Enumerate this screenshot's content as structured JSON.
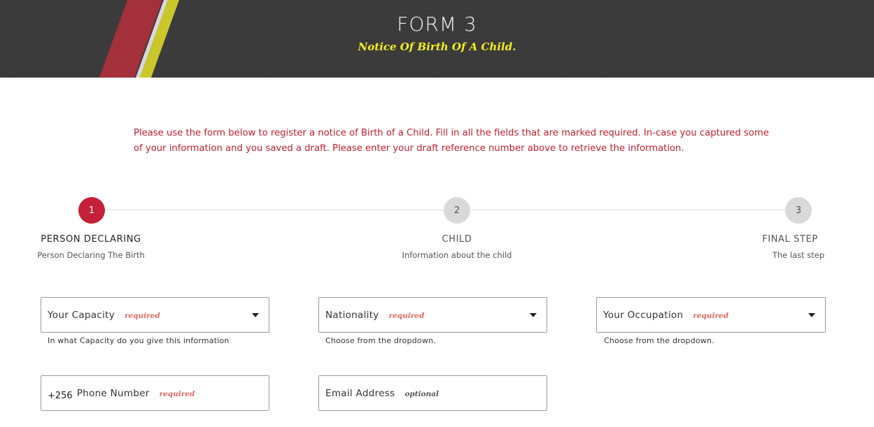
{
  "header": {
    "title": "FORM 3",
    "subtitle": "Notice Of Birth Of A Child.",
    "stripe_colors": [
      "#a3303a",
      "#c9c72a"
    ]
  },
  "intro": {
    "text": "Please use the form below to register a notice of Birth of a Child. Fill in all the fields that are marked required. In-case you captured some of your information and you saved a draft. Please enter your draft reference number above to retrieve the information."
  },
  "steps": [
    {
      "number": "1",
      "title": "PERSON DECLARING",
      "subtitle": "Person Declaring The Birth",
      "active": true
    },
    {
      "number": "2",
      "title": "CHILD",
      "subtitle": "Information about the child",
      "active": false
    },
    {
      "number": "3",
      "title": "FINAL STEP",
      "subtitle": "The last step",
      "active": false
    }
  ],
  "fields": {
    "capacity": {
      "label": "Your Capacity",
      "tag": "required",
      "help": "In what Capacity do you give this information"
    },
    "nationality": {
      "label": "Nationality",
      "tag": "required",
      "help": "Choose from the dropdown."
    },
    "occupation": {
      "label": "Your Occupation",
      "tag": "required",
      "help": "Choose from the dropdown."
    },
    "phone": {
      "prefix": "+256",
      "label": "Phone Number",
      "tag": "required"
    },
    "email": {
      "label": "Email Address",
      "tag": "optional"
    }
  },
  "colors": {
    "accent": "#c5203a",
    "required_tag": "#e0675f",
    "header_bg": "#3a3a3a",
    "subtitle_yellow": "#f4ef1d"
  }
}
